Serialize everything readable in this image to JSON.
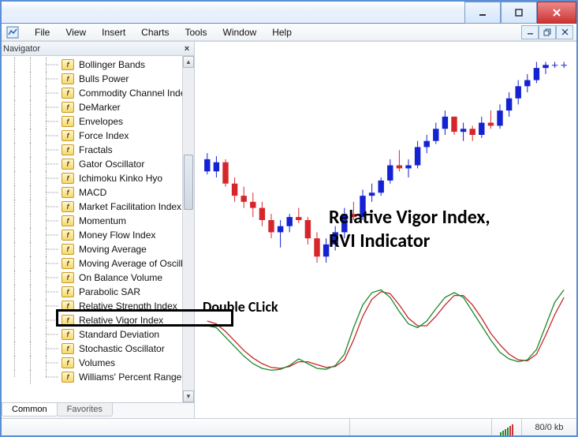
{
  "titlebar": {
    "minimize": "minimize",
    "maximize": "maximize",
    "close": "close"
  },
  "menubar": {
    "items": [
      "File",
      "View",
      "Insert",
      "Charts",
      "Tools",
      "Window",
      "Help"
    ]
  },
  "mdi": {
    "minimize": "_",
    "restore": "❐",
    "close": "×"
  },
  "navigator": {
    "title": "Navigator",
    "close": "×",
    "items": [
      "Bollinger Bands",
      "Bulls Power",
      "Commodity Channel Index",
      "DeMarker",
      "Envelopes",
      "Force Index",
      "Fractals",
      "Gator Oscillator",
      "Ichimoku Kinko Hyo",
      "MACD",
      "Market Facilitation Index",
      "Momentum",
      "Money Flow Index",
      "Moving Average",
      "Moving Average of Oscillat",
      "On Balance Volume",
      "Parabolic SAR",
      "Relative Strength Index",
      "Relative Vigor Index",
      "Standard Deviation",
      "Stochastic Oscillator",
      "Volumes",
      "Williams' Percent Range"
    ],
    "tabs": {
      "common": "Common",
      "favorites": "Favorites"
    }
  },
  "annotations": {
    "double_click": "Double CLick",
    "title1": "Relative Vigor Index,",
    "title2": "RVI Indicator"
  },
  "status": {
    "kb": "80/0 kb"
  },
  "chart_data": {
    "type": "candlestick_with_indicator",
    "description": "Price candlestick chart (upper pane) with RVI oscillator (lower pane). No axis labels visible.",
    "candles": [
      {
        "x": 0,
        "o": 64,
        "h": 66,
        "l": 59,
        "c": 60,
        "color": "blue"
      },
      {
        "x": 1,
        "o": 60,
        "h": 65,
        "l": 58,
        "c": 63,
        "color": "blue"
      },
      {
        "x": 2,
        "o": 63,
        "h": 64,
        "l": 55,
        "c": 56,
        "color": "red"
      },
      {
        "x": 3,
        "o": 56,
        "h": 58,
        "l": 50,
        "c": 52,
        "color": "red"
      },
      {
        "x": 4,
        "o": 52,
        "h": 55,
        "l": 48,
        "c": 50,
        "color": "red"
      },
      {
        "x": 5,
        "o": 50,
        "h": 53,
        "l": 45,
        "c": 48,
        "color": "red"
      },
      {
        "x": 6,
        "o": 48,
        "h": 50,
        "l": 42,
        "c": 44,
        "color": "red"
      },
      {
        "x": 7,
        "o": 44,
        "h": 46,
        "l": 38,
        "c": 40,
        "color": "red"
      },
      {
        "x": 8,
        "o": 40,
        "h": 44,
        "l": 35,
        "c": 42,
        "color": "blue"
      },
      {
        "x": 9,
        "o": 42,
        "h": 46,
        "l": 40,
        "c": 45,
        "color": "blue"
      },
      {
        "x": 10,
        "o": 45,
        "h": 48,
        "l": 43,
        "c": 44,
        "color": "red"
      },
      {
        "x": 11,
        "o": 44,
        "h": 45,
        "l": 36,
        "c": 38,
        "color": "red"
      },
      {
        "x": 12,
        "o": 38,
        "h": 40,
        "l": 30,
        "c": 32,
        "color": "red"
      },
      {
        "x": 13,
        "o": 32,
        "h": 38,
        "l": 30,
        "c": 36,
        "color": "blue"
      },
      {
        "x": 14,
        "o": 36,
        "h": 42,
        "l": 34,
        "c": 40,
        "color": "blue"
      },
      {
        "x": 15,
        "o": 40,
        "h": 48,
        "l": 38,
        "c": 46,
        "color": "blue"
      },
      {
        "x": 16,
        "o": 46,
        "h": 50,
        "l": 44,
        "c": 45,
        "color": "red"
      },
      {
        "x": 17,
        "o": 45,
        "h": 54,
        "l": 44,
        "c": 52,
        "color": "blue"
      },
      {
        "x": 18,
        "o": 52,
        "h": 56,
        "l": 50,
        "c": 53,
        "color": "blue"
      },
      {
        "x": 19,
        "o": 53,
        "h": 58,
        "l": 52,
        "c": 57,
        "color": "blue"
      },
      {
        "x": 20,
        "o": 57,
        "h": 64,
        "l": 56,
        "c": 62,
        "color": "blue"
      },
      {
        "x": 21,
        "o": 62,
        "h": 67,
        "l": 60,
        "c": 61,
        "color": "red"
      },
      {
        "x": 22,
        "o": 61,
        "h": 64,
        "l": 58,
        "c": 62,
        "color": "blue"
      },
      {
        "x": 23,
        "o": 62,
        "h": 70,
        "l": 61,
        "c": 68,
        "color": "blue"
      },
      {
        "x": 24,
        "o": 68,
        "h": 72,
        "l": 66,
        "c": 70,
        "color": "blue"
      },
      {
        "x": 25,
        "o": 70,
        "h": 76,
        "l": 69,
        "c": 74,
        "color": "blue"
      },
      {
        "x": 26,
        "o": 74,
        "h": 80,
        "l": 72,
        "c": 78,
        "color": "blue"
      },
      {
        "x": 27,
        "o": 78,
        "h": 78,
        "l": 72,
        "c": 73,
        "color": "red"
      },
      {
        "x": 28,
        "o": 73,
        "h": 76,
        "l": 70,
        "c": 74,
        "color": "blue"
      },
      {
        "x": 29,
        "o": 74,
        "h": 75,
        "l": 70,
        "c": 72,
        "color": "red"
      },
      {
        "x": 30,
        "o": 72,
        "h": 78,
        "l": 71,
        "c": 76,
        "color": "blue"
      },
      {
        "x": 31,
        "o": 76,
        "h": 80,
        "l": 74,
        "c": 75,
        "color": "red"
      },
      {
        "x": 32,
        "o": 75,
        "h": 82,
        "l": 74,
        "c": 80,
        "color": "blue"
      },
      {
        "x": 33,
        "o": 80,
        "h": 86,
        "l": 78,
        "c": 84,
        "color": "blue"
      },
      {
        "x": 34,
        "o": 84,
        "h": 90,
        "l": 82,
        "c": 88,
        "color": "blue"
      },
      {
        "x": 35,
        "o": 88,
        "h": 92,
        "l": 86,
        "c": 90,
        "color": "blue"
      },
      {
        "x": 36,
        "o": 90,
        "h": 96,
        "l": 89,
        "c": 94,
        "color": "blue"
      },
      {
        "x": 37,
        "o": 94,
        "h": 96,
        "l": 92,
        "c": 95,
        "color": "blue"
      },
      {
        "x": 38,
        "o": 95,
        "h": 96,
        "l": 94,
        "c": 95,
        "color": "blue"
      },
      {
        "x": 39,
        "o": 95,
        "h": 96,
        "l": 94,
        "c": 95,
        "color": "blue"
      }
    ],
    "y_range_candles": [
      30,
      100
    ],
    "rvi": {
      "main": [
        50,
        48,
        38,
        28,
        18,
        10,
        5,
        3,
        4,
        8,
        15,
        10,
        5,
        4,
        8,
        20,
        48,
        72,
        85,
        88,
        80,
        65,
        52,
        48,
        55,
        68,
        80,
        85,
        80,
        65,
        50,
        35,
        22,
        15,
        12,
        14,
        25,
        50,
        75,
        88
      ],
      "signal": [
        55,
        52,
        44,
        34,
        24,
        16,
        10,
        6,
        5,
        7,
        12,
        12,
        9,
        6,
        7,
        14,
        35,
        60,
        78,
        86,
        84,
        72,
        58,
        50,
        50,
        60,
        72,
        82,
        82,
        72,
        58,
        42,
        30,
        20,
        14,
        13,
        20,
        40,
        62,
        80
      ],
      "y_range": [
        0,
        100
      ]
    }
  }
}
